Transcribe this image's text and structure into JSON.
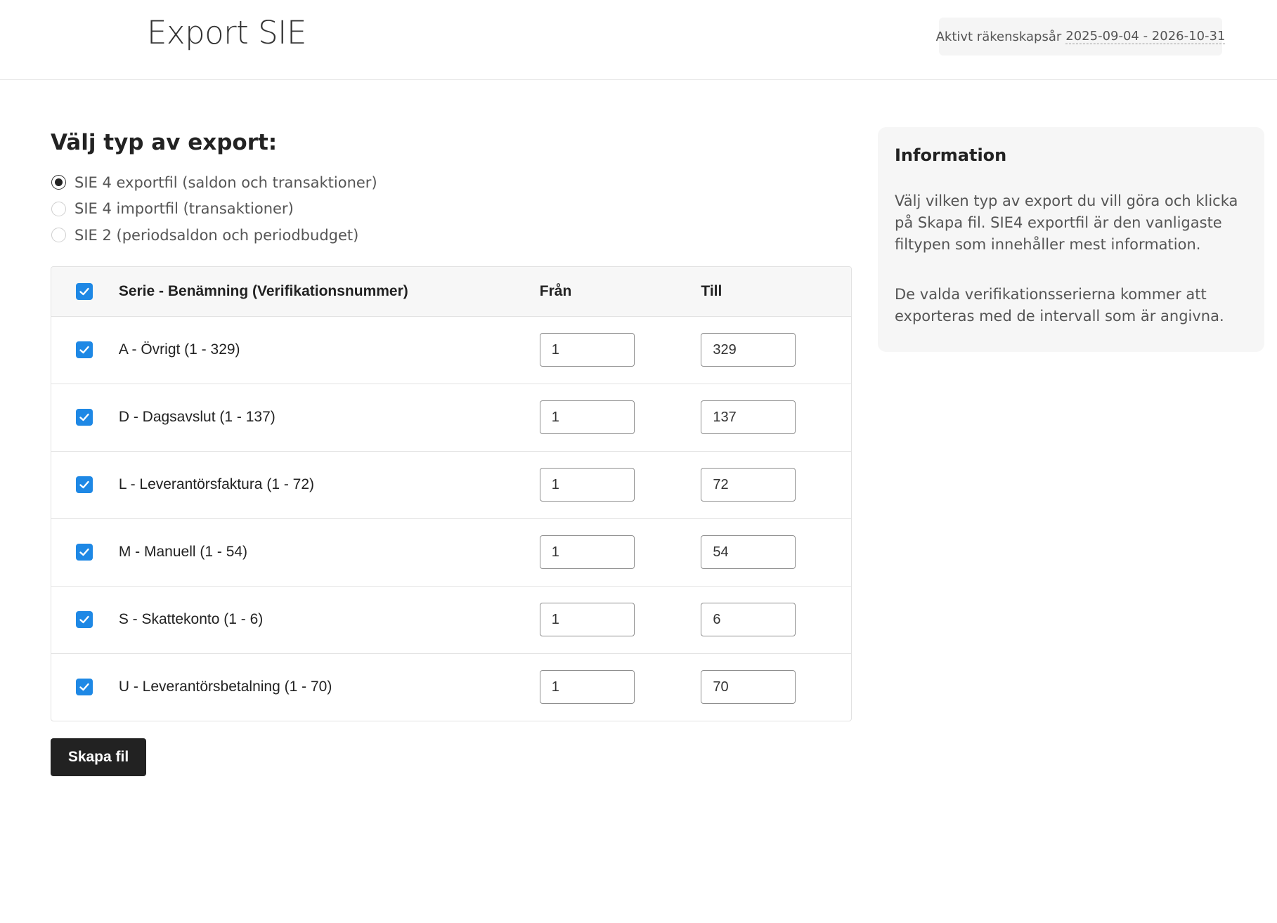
{
  "header": {
    "title": "Export SIE",
    "fiscal_year_label": "Aktivt räkenskapsår",
    "fiscal_year_value": "2025-09-04 - 2026-10-31"
  },
  "export_type": {
    "heading": "Välj typ av export:",
    "options": [
      {
        "label": "SIE 4 exportfil (saldon och transaktioner)",
        "checked": true
      },
      {
        "label": "SIE 4 importfil (transaktioner)",
        "checked": false
      },
      {
        "label": "SIE 2 (periodsaldon och periodbudget)",
        "checked": false
      }
    ]
  },
  "table": {
    "headers": {
      "name": "Serie - Benämning (Verifikationsnummer)",
      "from": "Från",
      "to": "Till"
    },
    "all_checked": true,
    "rows": [
      {
        "name": "A - Övrigt (1 - 329)",
        "from": "1",
        "to": "329",
        "checked": true
      },
      {
        "name": "D - Dagsavslut (1 - 137)",
        "from": "1",
        "to": "137",
        "checked": true
      },
      {
        "name": "L - Leverantörsfaktura (1 - 72)",
        "from": "1",
        "to": "72",
        "checked": true
      },
      {
        "name": "M - Manuell (1 - 54)",
        "from": "1",
        "to": "54",
        "checked": true
      },
      {
        "name": "S - Skattekonto (1 - 6)",
        "from": "1",
        "to": "6",
        "checked": true
      },
      {
        "name": "U - Leverantörsbetalning (1 - 70)",
        "from": "1",
        "to": "70",
        "checked": true
      }
    ]
  },
  "actions": {
    "create_label": "Skapa fil"
  },
  "info": {
    "title": "Information",
    "paragraphs": [
      "Välj vilken typ av export du vill göra och klicka på Skapa fil. SIE4 exportfil är den vanligaste filtypen som innehåller mest information.",
      "De valda verifikationsserierna kommer att exporteras med de intervall som är angivna."
    ]
  },
  "colors": {
    "accent": "#1e88e5",
    "button_bg": "#222222",
    "panel_bg": "#f6f6f6"
  }
}
